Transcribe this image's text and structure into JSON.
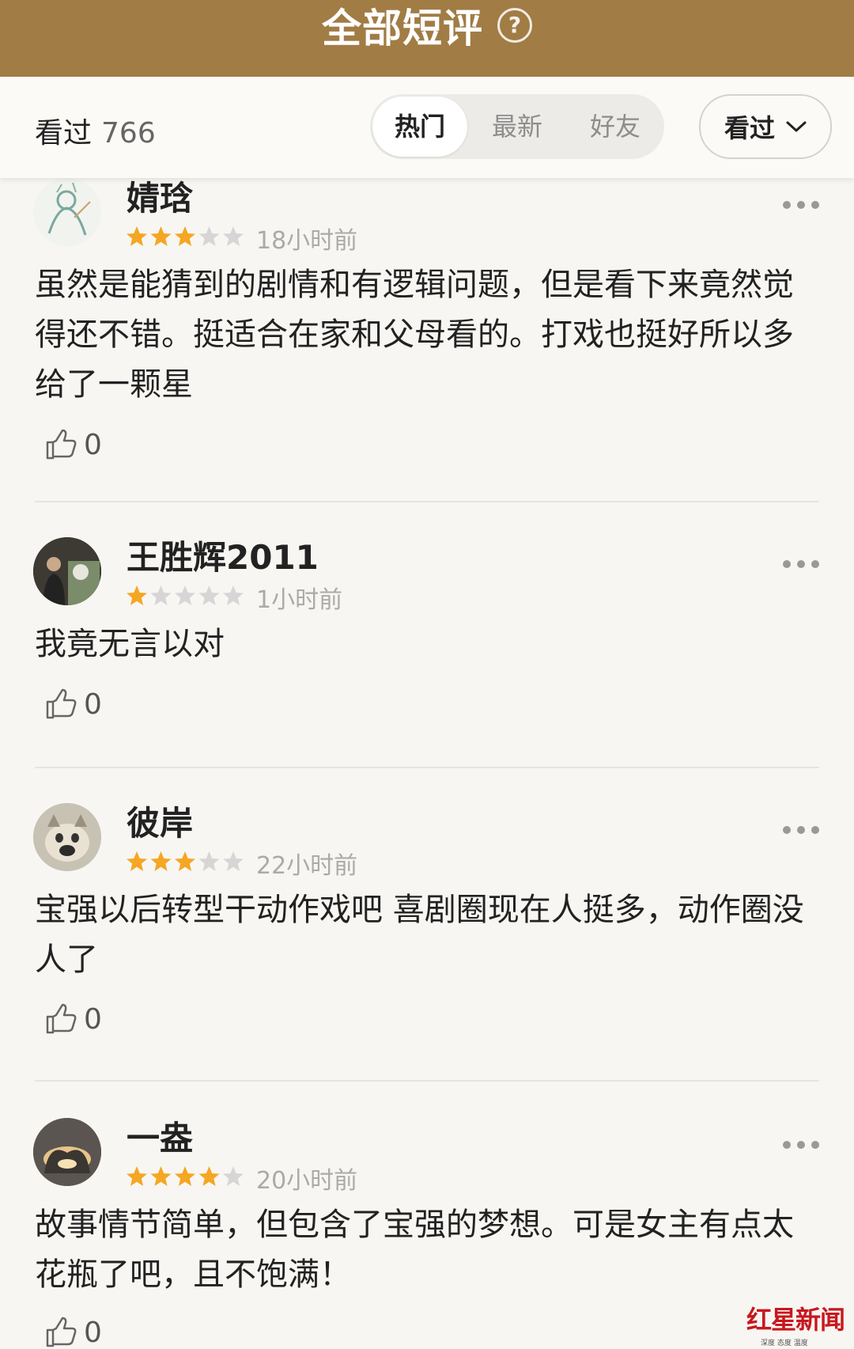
{
  "header": {
    "title": "全部短评",
    "help_icon": "question-mark-icon"
  },
  "filter": {
    "count_label": "看过",
    "count_value": "766",
    "tabs": [
      {
        "label": "热门",
        "active": true
      },
      {
        "label": "最新",
        "active": false
      },
      {
        "label": "好友",
        "active": false
      }
    ],
    "dropdown_label": "看过"
  },
  "colors": {
    "header_bg": "#a17c45",
    "star_on": "#f5a623",
    "star_off": "#d6d6d6"
  },
  "comments": [
    {
      "user": "婧琀",
      "stars": 3,
      "time": "18小时前",
      "text": "虽然是能猜到的剧情和有逻辑问题，但是看下来竟然觉得还不错。挺适合在家和父母看的。打戏也挺好所以多给了一颗星",
      "likes": "0"
    },
    {
      "user": "王胜辉2011",
      "stars": 1,
      "time": "1小时前",
      "text": "我竟无言以对",
      "likes": "0"
    },
    {
      "user": "彼岸",
      "stars": 3,
      "time": "22小时前",
      "text": "宝强以后转型干动作戏吧 喜剧圈现在人挺多，动作圈没人了",
      "likes": "0"
    },
    {
      "user": "一盎",
      "stars": 4,
      "time": "20小时前",
      "text": "故事情节简单，但包含了宝强的梦想。可是女主有点太花瓶了吧，且不饱满！",
      "likes": "0"
    }
  ],
  "watermark": {
    "text": "红星新闻",
    "subtitle": "深度 态度 温度"
  }
}
